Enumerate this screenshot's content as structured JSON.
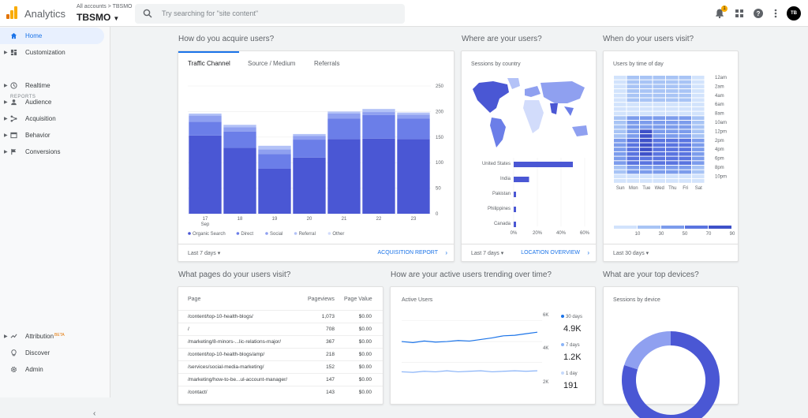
{
  "header": {
    "app_name": "Analytics",
    "account_crumb": "All accounts > TBSMO",
    "account_name": "TBSMO",
    "search_placeholder": "Try searching for \"site content\"",
    "notification_count": "1",
    "avatar_initials": "TB",
    "icons": [
      "bell-icon",
      "apps-icon",
      "help-icon",
      "more-vert-icon"
    ]
  },
  "sidebar": {
    "top_items": [
      {
        "label": "Home",
        "icon": "home-icon",
        "active": true
      },
      {
        "label": "Customization",
        "icon": "dashboard-icon"
      }
    ],
    "reports_header": "REPORTS",
    "report_items": [
      {
        "label": "Realtime",
        "icon": "clock-icon"
      },
      {
        "label": "Audience",
        "icon": "person-icon"
      },
      {
        "label": "Acquisition",
        "icon": "acquisition-icon"
      },
      {
        "label": "Behavior",
        "icon": "behavior-icon"
      },
      {
        "label": "Conversions",
        "icon": "flag-icon"
      }
    ],
    "bottom_items": [
      {
        "label": "Attribution",
        "badge": "BETA",
        "icon": "attribution-icon"
      },
      {
        "label": "Discover",
        "icon": "lightbulb-icon"
      },
      {
        "label": "Admin",
        "icon": "gear-icon"
      }
    ],
    "collapse": "‹"
  },
  "acquire": {
    "title": "How do you acquire users?",
    "tabs": [
      "Traffic Channel",
      "Source / Medium",
      "Referrals"
    ],
    "footer_range": "Last 7 days",
    "footer_link": "ACQUISITION REPORT"
  },
  "where": {
    "title": "Where are your users?",
    "subtitle": "Sessions by country",
    "footer_range": "Last 7 days",
    "footer_link": "LOCATION OVERVIEW"
  },
  "when": {
    "title": "When do your users visit?",
    "subtitle": "Users by time of day",
    "footer_range": "Last 30 days"
  },
  "pages": {
    "title": "What pages do your users visit?",
    "col_page": "Page",
    "col_views": "Pageviews",
    "col_value": "Page Value",
    "rows": [
      {
        "page": "/content/top-10-health-blogs/",
        "views": "1,073",
        "value": "$0.00"
      },
      {
        "page": "/",
        "views": "708",
        "value": "$0.00"
      },
      {
        "page": "/marketing/8-minors-...lic-relations-major/",
        "views": "367",
        "value": "$0.00"
      },
      {
        "page": "/content/top-10-health-blogs/amp/",
        "views": "218",
        "value": "$0.00"
      },
      {
        "page": "/services/social-media-marketing/",
        "views": "152",
        "value": "$0.00"
      },
      {
        "page": "/marketing/how-to-be...ul-account-manager/",
        "views": "147",
        "value": "$0.00"
      },
      {
        "page": "/contact/",
        "views": "143",
        "value": "$0.00"
      }
    ]
  },
  "active": {
    "title": "How are your active users trending over time?",
    "subtitle": "Active Users",
    "stats": [
      {
        "label": "30 days",
        "value": "4.9K",
        "color": "#1a73e8"
      },
      {
        "label": "7 days",
        "value": "1.2K",
        "color": "#8ab4f8"
      },
      {
        "label": "1 day",
        "value": "191",
        "color": "#c6dafc"
      }
    ],
    "y_ticks": [
      "6K",
      "4K",
      "2K"
    ]
  },
  "devices": {
    "title": "What are your top devices?",
    "subtitle": "Sessions by device"
  },
  "chart_data": [
    {
      "type": "bar",
      "stacked": true,
      "categories": [
        "17",
        "18",
        "19",
        "20",
        "21",
        "22",
        "23"
      ],
      "x_sublabel": "Sep",
      "ylim": [
        0,
        250
      ],
      "y_ticks": [
        "250",
        "200",
        "150",
        "100",
        "50",
        "0"
      ],
      "series": [
        {
          "name": "Organic Search",
          "color": "#4a57d4",
          "values": [
            153,
            129,
            88,
            110,
            146,
            147,
            146
          ]
        },
        {
          "name": "Direct",
          "color": "#6b7ee8",
          "values": [
            27,
            32,
            29,
            35,
            40,
            46,
            40
          ]
        },
        {
          "name": "Social",
          "color": "#8fa0f0",
          "values": [
            12,
            8,
            9,
            7,
            10,
            6,
            8
          ]
        },
        {
          "name": "Referral",
          "color": "#b3c2f7",
          "values": [
            4,
            5,
            7,
            4,
            4,
            6,
            4
          ]
        },
        {
          "name": "Other",
          "color": "#d2dcfb",
          "values": [
            0,
            0,
            0,
            0,
            0,
            0,
            0
          ]
        }
      ]
    },
    {
      "type": "bar",
      "orientation": "horizontal",
      "categories": [
        "United States",
        "India",
        "Pakistan",
        "Philippines",
        "Canada"
      ],
      "values": [
        50,
        13,
        2,
        2,
        2
      ],
      "x_ticks": [
        "0%",
        "20%",
        "40%",
        "60%"
      ],
      "xlim": [
        0,
        60
      ],
      "color": "#4a57d4"
    },
    {
      "type": "heatmap",
      "x": [
        "Sun",
        "Mon",
        "Tue",
        "Wed",
        "Thu",
        "Fri",
        "Sat"
      ],
      "y": [
        "12am",
        "2am",
        "4am",
        "6am",
        "8am",
        "10am",
        "12pm",
        "2pm",
        "4pm",
        "6pm",
        "8pm",
        "10pm"
      ],
      "legend_ticks": [
        "10",
        "30",
        "50",
        "70",
        "90"
      ]
    },
    {
      "type": "line",
      "series": [
        {
          "name": "30 days",
          "color": "#1a73e8",
          "values": [
            4.0,
            3.9,
            4.05,
            3.95,
            4.0,
            4.1,
            4.05,
            4.2,
            4.35,
            4.55,
            4.6,
            4.75,
            4.9
          ]
        },
        {
          "name": "7 days",
          "color": "#8ab4f8",
          "values": [
            1.1,
            1.05,
            1.15,
            1.1,
            1.2,
            1.1,
            1.15,
            1.2,
            1.1,
            1.15,
            1.2,
            1.15,
            1.2
          ]
        }
      ],
      "ylim": [
        0,
        6.5
      ]
    },
    {
      "type": "pie",
      "donut": true,
      "values": [
        80,
        20
      ],
      "colors": [
        "#4a57d4",
        "#8fa0f0"
      ]
    }
  ]
}
